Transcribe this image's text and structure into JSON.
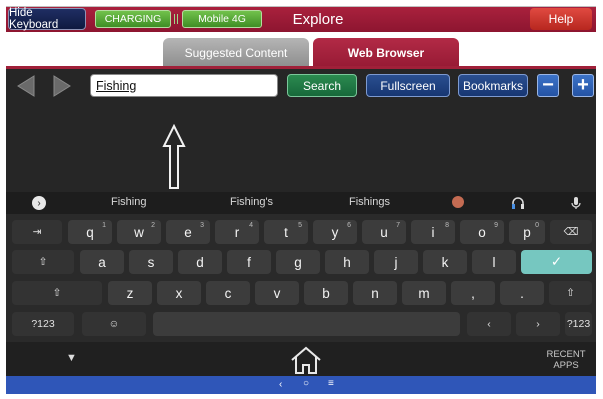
{
  "header": {
    "hide_keyboard": "Hide Keyboard",
    "charging": "CHARGING",
    "network": "Mobile 4G",
    "title": "Explore",
    "help": "Help"
  },
  "tabs": [
    {
      "label": "Suggested Content",
      "active": false
    },
    {
      "label": "Web Browser",
      "active": true
    }
  ],
  "toolbar": {
    "url_value": "Fishing",
    "search": "Search",
    "fullscreen": "Fullscreen",
    "bookmarks": "Bookmarks",
    "zoom_out": "−",
    "zoom_in": "+"
  },
  "keyboard": {
    "suggestions": [
      "Fishing",
      "Fishing's",
      "Fishings"
    ],
    "row1": [
      {
        "k": "q",
        "h": "1"
      },
      {
        "k": "w",
        "h": "2"
      },
      {
        "k": "e",
        "h": "3"
      },
      {
        "k": "r",
        "h": "4"
      },
      {
        "k": "t",
        "h": "5"
      },
      {
        "k": "y",
        "h": "6"
      },
      {
        "k": "u",
        "h": "7"
      },
      {
        "k": "i",
        "h": "8"
      },
      {
        "k": "o",
        "h": "9"
      },
      {
        "k": "p",
        "h": "0"
      }
    ],
    "row2": [
      "a",
      "s",
      "d",
      "f",
      "g",
      "h",
      "j",
      "k",
      "l"
    ],
    "row3": [
      "z",
      "x",
      "c",
      "v",
      "b",
      "n",
      "m",
      ",",
      "."
    ],
    "symbols": "?123",
    "symbols_right": "?123",
    "recent_apps": "RECENT APPS"
  },
  "colors": {
    "header_red": "#a9213d",
    "green": "#3f8e25",
    "blue": "#173672",
    "enter_teal": "#76c7c0",
    "nav_blue": "#2f56b8"
  }
}
